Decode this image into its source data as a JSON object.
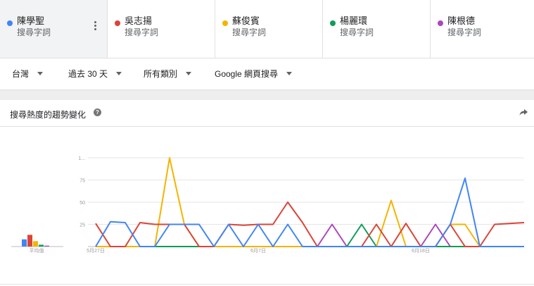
{
  "terms": [
    {
      "name": "陳學聖",
      "sub": "搜尋字詞",
      "color": "#4285f4",
      "active": true
    },
    {
      "name": "吳志揚",
      "sub": "搜尋字詞",
      "color": "#db4437",
      "active": false
    },
    {
      "name": "蘇俊賓",
      "sub": "搜尋字詞",
      "color": "#f4b400",
      "active": false
    },
    {
      "name": "楊麗環",
      "sub": "搜尋字詞",
      "color": "#0f9d58",
      "active": false
    },
    {
      "name": "陳根德",
      "sub": "搜尋字詞",
      "color": "#ab47bc",
      "active": false
    }
  ],
  "filters": {
    "region": "台灣",
    "time": "過去 30 天",
    "category": "所有類別",
    "search_type": "Google 網頁搜尋"
  },
  "card": {
    "title": "搜尋熱度的趨勢變化"
  },
  "average": {
    "label": "平均值",
    "values": [
      8,
      13,
      6,
      2,
      1
    ]
  },
  "chart_data": {
    "type": "line",
    "ylim": [
      0,
      100
    ],
    "yticks": [
      "1...",
      "75",
      "50",
      "25"
    ],
    "xticks": [
      {
        "label": "5月27日",
        "index": 0
      },
      {
        "label": "6月7日",
        "index": 11
      },
      {
        "label": "6月18日",
        "index": 22
      }
    ],
    "series": [
      {
        "name": "陳學聖",
        "color": "#4285f4",
        "values": [
          0,
          28,
          27,
          0,
          0,
          25,
          25,
          25,
          0,
          25,
          0,
          25,
          0,
          25,
          0,
          0,
          0,
          0,
          0,
          0,
          0,
          0,
          0,
          0,
          25,
          77,
          0,
          0,
          0,
          0
        ]
      },
      {
        "name": "吳志揚",
        "color": "#db4437",
        "values": [
          26,
          0,
          0,
          27,
          25,
          25,
          25,
          0,
          0,
          25,
          24,
          25,
          25,
          50,
          27,
          0,
          0,
          0,
          0,
          25,
          0,
          26,
          0,
          0,
          25,
          0,
          0,
          25,
          26,
          27,
          0
        ]
      },
      {
        "name": "蘇俊賓",
        "color": "#f4b400",
        "values": [
          0,
          0,
          0,
          0,
          0,
          100,
          25,
          0,
          0,
          0,
          0,
          0,
          0,
          0,
          0,
          0,
          0,
          0,
          0,
          0,
          52,
          0,
          0,
          0,
          25,
          25,
          0,
          0,
          0,
          0,
          0
        ]
      },
      {
        "name": "楊麗環",
        "color": "#0f9d58",
        "values": [
          0,
          0,
          0,
          0,
          0,
          0,
          0,
          0,
          0,
          0,
          0,
          0,
          0,
          0,
          0,
          0,
          0,
          0,
          25,
          0,
          0,
          0,
          0,
          0,
          0,
          0,
          0,
          0,
          0,
          0,
          0
        ]
      },
      {
        "name": "陳根德",
        "color": "#ab47bc",
        "values": [
          0,
          0,
          0,
          0,
          0,
          0,
          0,
          0,
          0,
          0,
          0,
          0,
          0,
          0,
          0,
          0,
          25,
          0,
          0,
          0,
          0,
          0,
          0,
          25,
          0,
          0,
          0,
          0,
          0,
          0,
          0
        ]
      }
    ]
  }
}
